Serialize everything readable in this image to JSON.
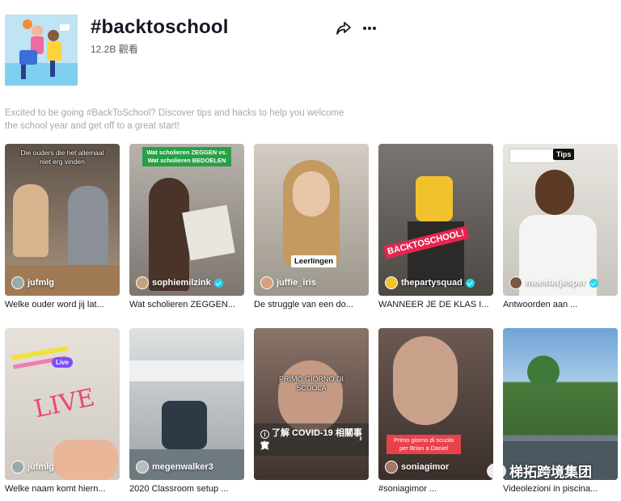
{
  "header": {
    "title": "#backtoschool",
    "views": "12.2B 觀看",
    "share_icon": "share-icon",
    "more_icon": "more-icon"
  },
  "description": "Excited to be going #BackToSchool? Discover tips and hacks to help you welcome the school year and get off to a great start!",
  "videos": [
    {
      "user": "jufmlg",
      "verified": false,
      "caption": "Welke ouder word jij lat...",
      "overlay": "Die ouders die het allemaal niet erg vinden",
      "bg": "#8b7a66"
    },
    {
      "user": "sophiemilzink",
      "verified": true,
      "caption": "Wat scholieren ZEGGEN...",
      "overlay": "Wat scholieren ZEGGEN vs. Wat scholieren BEDOELEN",
      "bg": "#9a938d"
    },
    {
      "user": "juffie_iris",
      "verified": false,
      "caption": "De struggle van een do...",
      "overlay": "Leerlingen",
      "bg": "#b8b2a8"
    },
    {
      "user": "thepartysquad",
      "verified": true,
      "caption": "WANNEER JE DE KLAS I...",
      "overlay": "BACKTOSCHOOL!",
      "bg": "#6e6a66"
    },
    {
      "user": "meesterjesper",
      "verified": true,
      "caption": "Antwoorden aan ...",
      "overlay": "Tips",
      "bg": "#d8d6d0"
    },
    {
      "user": "jufmlg",
      "verified": false,
      "caption": "Welke naam komt hiern...",
      "overlay": "Live",
      "bg": "#d9d4ce"
    },
    {
      "user": "megenwalker3",
      "verified": false,
      "caption": "2020 Classroom setup ...",
      "overlay": "",
      "bg": "#8f9aa0"
    },
    {
      "user": "",
      "verified": false,
      "caption": "",
      "overlay": "PRIMO GIORNO DI SCUOLA",
      "bg": "#6b5a52"
    },
    {
      "user": "soniagimor",
      "verified": false,
      "caption": "#soniagimor ...",
      "overlay": "Primo giorno di scuola per Brian a Daniel",
      "bg": "#5b4b44"
    },
    {
      "user": "",
      "verified": false,
      "caption": "Videolezioni in piscina...",
      "overlay": "",
      "bg": "#5d8fc2"
    }
  ],
  "covid_notice": {
    "text": "了解 COVID-19 相關事實",
    "icon": "info-icon"
  },
  "watermark": {
    "text": "梯拓跨境集团",
    "icon": "wechat-icon"
  }
}
